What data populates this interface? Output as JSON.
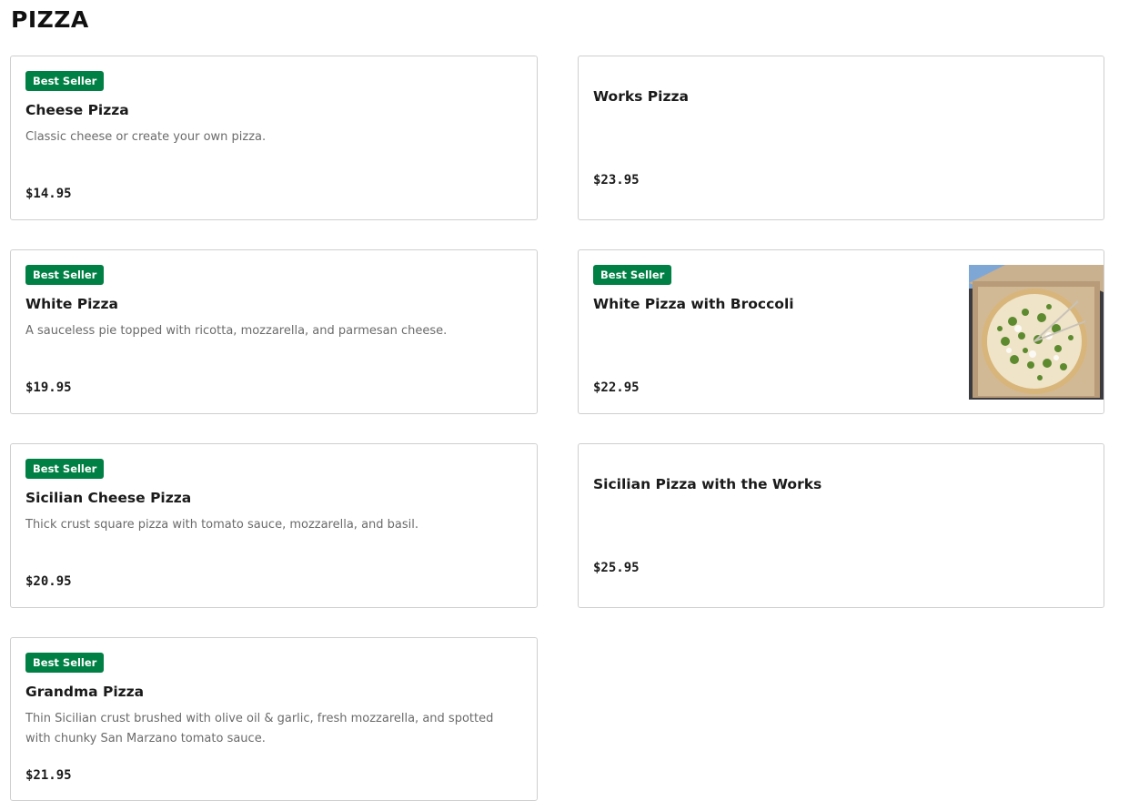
{
  "section": {
    "title": "PIZZA"
  },
  "items": [
    {
      "badge": "Best Seller",
      "name": "Cheese Pizza",
      "description": "Classic cheese or create your own pizza.",
      "price": "$14.95"
    },
    {
      "name": "Works Pizza",
      "price": "$23.95"
    },
    {
      "badge": "Best Seller",
      "name": "White Pizza",
      "description": "A sauceless pie topped with ricotta, mozzarella, and parmesan cheese.",
      "price": "$19.95"
    },
    {
      "badge": "Best Seller",
      "name": "White Pizza with Broccoli",
      "price": "$22.95",
      "image": "white-pizza-broccoli-photo"
    },
    {
      "badge": "Best Seller",
      "name": "Sicilian Cheese Pizza",
      "description": "Thick crust square pizza with tomato sauce, mozzarella, and basil.",
      "price": "$20.95"
    },
    {
      "name": "Sicilian Pizza with the Works",
      "price": "$25.95"
    },
    {
      "badge": "Best Seller",
      "name": "Grandma Pizza",
      "description": "Thin Sicilian crust brushed with olive oil & garlic, fresh mozzarella, and spotted with chunky San Marzano tomato sauce.",
      "price": "$21.95"
    }
  ],
  "colors": {
    "badge_bg": "#008044",
    "badge_text": "#ffffff",
    "card_border": "#cfcfcf",
    "description_text": "#6b6b6b"
  }
}
